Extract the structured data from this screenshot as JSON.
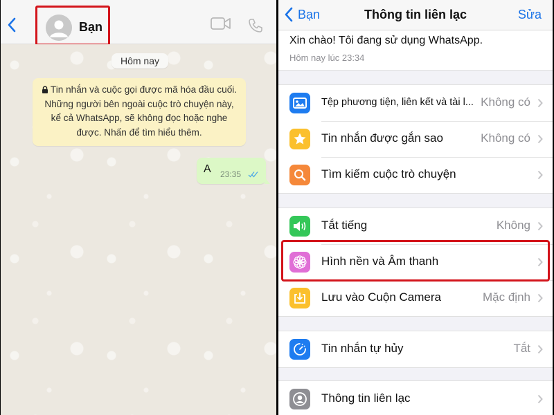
{
  "left": {
    "header": {
      "contact_name": "Bạn",
      "icons": [
        "back-chevron-icon",
        "avatar-placeholder-icon",
        "video-call-icon",
        "phone-call-icon"
      ]
    },
    "date_separator": "Hôm nay",
    "encryption_notice": "Tin nhắn và cuộc gọi được mã hóa đầu cuối. Những người bên ngoài cuộc trò chuyện này, kể cả WhatsApp, sẽ không đọc hoặc nghe được. Nhấn để tìm hiểu thêm.",
    "messages": [
      {
        "direction": "outgoing",
        "text": "A",
        "time": "23:35",
        "status": "read"
      }
    ]
  },
  "right": {
    "nav": {
      "back_label": "Bạn",
      "title": "Thông tin liên lạc",
      "edit_label": "Sửa"
    },
    "about": {
      "text": "Xin chào! Tôi đang sử dụng WhatsApp.",
      "time": "Hôm nay lúc 23:34"
    },
    "groups": [
      {
        "rows": [
          {
            "icon": "photo-icon",
            "color": "#1e7cf0",
            "label": "Tệp phương tiện, liên kết và tài l...",
            "value": "Không có"
          },
          {
            "icon": "star-icon",
            "color": "#fbc02d",
            "label": "Tin nhắn được gắn sao",
            "value": "Không có"
          },
          {
            "icon": "search-icon",
            "color": "#f5883a",
            "label": "Tìm kiếm cuộc trò chuyện",
            "value": ""
          }
        ]
      },
      {
        "rows": [
          {
            "icon": "speaker-icon",
            "color": "#34c759",
            "label": "Tắt tiếng",
            "value": "Không"
          },
          {
            "icon": "flower-icon",
            "color": "#e06fd6",
            "label": "Hình nền và Âm thanh",
            "value": "",
            "highlighted": true
          },
          {
            "icon": "download-icon",
            "color": "#fbc02d",
            "label": "Lưu vào Cuộn Camera",
            "value": "Mặc định"
          }
        ]
      },
      {
        "rows": [
          {
            "icon": "timer-icon",
            "color": "#1e7cf0",
            "label": "Tin nhắn tự hủy",
            "value": "Tắt"
          }
        ]
      },
      {
        "rows": [
          {
            "icon": "contact-icon",
            "color": "#8e8e93",
            "label": "Thông tin liên lạc",
            "value": ""
          }
        ]
      }
    ]
  },
  "colors": {
    "highlight": "#d3141b",
    "ios_blue": "#1a73e8",
    "chat_bg": "#ece8e0",
    "bubble_out": "#dcf8c6",
    "notice_bg": "#fbf2c5",
    "read_tick": "#4fa9e6"
  }
}
